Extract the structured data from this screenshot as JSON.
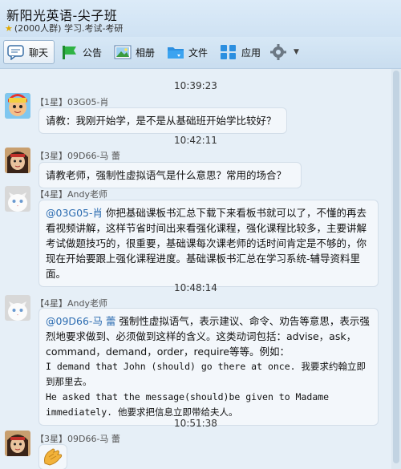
{
  "header": {
    "title": "新阳光英语-尖子班",
    "subtitle": "(2000人群) 学习.考试-考研"
  },
  "toolbar": {
    "chat": "聊天",
    "announce": "公告",
    "album": "相册",
    "files": "文件",
    "apps": "应用"
  },
  "messages": [
    {
      "time": "10:39:23",
      "sender": "【1星】03G05-肖",
      "text": "请教：我刚开始学，是不是从基础班开始学比较好？"
    },
    {
      "time": "10:42:11",
      "sender": "【3星】09D66-马  蕾",
      "text": "请教老师，强制性虚拟语气是什么意思？常用的场合？"
    },
    {
      "sender": "【4星】Andy老师",
      "mention": "@03G05-肖",
      "text": " 你把基础课板书汇总下载下来看板书就可以了，不懂的再去看视频讲解，这样节省时间出来看强化课程，强化课程比较多，主要讲解考试做题技巧的，很重要，基础课每次课老师的话时间肯定是不够的，你现在开始要跟上强化课程进度。基础课板书汇总在学习系统-辅导资料里面。"
    },
    {
      "time": "10:48:14",
      "sender": "【4星】Andy老师",
      "mention": "@09D66-马  蕾",
      "text": " 强制性虚拟语气，表示建议、命令、劝告等意思，表示强烈地要求做到、必须做到这样的含义。这类动词包括：advise，ask，command，demand，order，require等等。例如：",
      "ex1": "I demand that John (should) go there at once. 我要求约翰立即到那里去。",
      "ex2": "He asked that the message(should)be given to Madame immediately. 他要求把信息立即带给夫人。"
    },
    {
      "time": "10:51:38",
      "sender": "【3星】09D66-马  蕾"
    }
  ]
}
